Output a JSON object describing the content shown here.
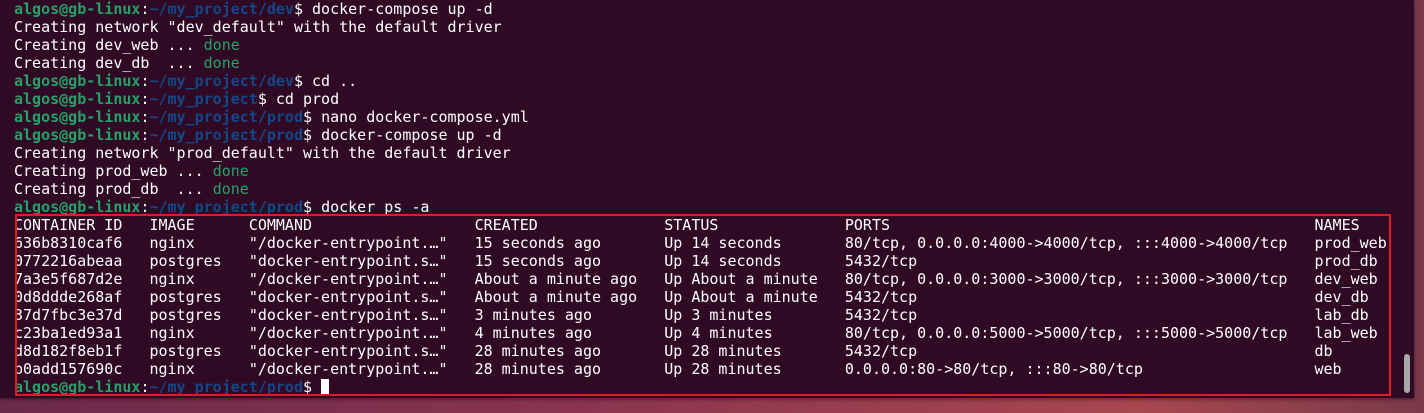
{
  "terminal": {
    "prompt_user": "algos@gb-linux",
    "colors": {
      "user": "#26a269",
      "path": "#12488b",
      "text": "#ffffff",
      "done": "#26a269",
      "background": "#300a24",
      "highlight_box": "#e01b24"
    },
    "history": [
      {
        "type": "prompt",
        "path": "~/my_project/dev",
        "command": "docker-compose up -d"
      },
      {
        "type": "output",
        "text": "Creating network \"dev_default\" with the default driver"
      },
      {
        "type": "status",
        "text": "Creating dev_web ... ",
        "status": "done"
      },
      {
        "type": "status",
        "text": "Creating dev_db  ... ",
        "status": "done"
      },
      {
        "type": "prompt",
        "path": "~/my_project/dev",
        "command": "cd .."
      },
      {
        "type": "prompt",
        "path": "~/my_project",
        "command": "cd prod"
      },
      {
        "type": "prompt",
        "path": "~/my_project/prod",
        "command": "nano docker-compose.yml"
      },
      {
        "type": "prompt",
        "path": "~/my_project/prod",
        "command": "docker-compose up -d"
      },
      {
        "type": "output",
        "text": "Creating network \"prod_default\" with the default driver"
      },
      {
        "type": "status",
        "text": "Creating prod_web ... ",
        "status": "done"
      },
      {
        "type": "status",
        "text": "Creating prod_db  ... ",
        "status": "done"
      },
      {
        "type": "prompt",
        "path": "~/my_project/prod",
        "command": "docker ps -a"
      }
    ],
    "ps_table": {
      "columns": [
        "CONTAINER ID",
        "IMAGE",
        "COMMAND",
        "CREATED",
        "STATUS",
        "PORTS",
        "NAMES"
      ],
      "rows": [
        [
          "636b8310caf6",
          "nginx",
          "\"/docker-entrypoint.…\"",
          "15 seconds ago",
          "Up 14 seconds",
          "80/tcp, 0.0.0.0:4000->4000/tcp, :::4000->4000/tcp",
          "prod_web"
        ],
        [
          "0772216abeaa",
          "postgres",
          "\"docker-entrypoint.s…\"",
          "15 seconds ago",
          "Up 14 seconds",
          "5432/tcp",
          "prod_db"
        ],
        [
          "7a3e5f687d2e",
          "nginx",
          "\"/docker-entrypoint.…\"",
          "About a minute ago",
          "Up About a minute",
          "80/tcp, 0.0.0.0:3000->3000/tcp, :::3000->3000/tcp",
          "dev_web"
        ],
        [
          "0d8ddde268af",
          "postgres",
          "\"docker-entrypoint.s…\"",
          "About a minute ago",
          "Up About a minute",
          "5432/tcp",
          "dev_db"
        ],
        [
          "37d7fbc3e37d",
          "postgres",
          "\"docker-entrypoint.s…\"",
          "3 minutes ago",
          "Up 3 minutes",
          "5432/tcp",
          "lab_db"
        ],
        [
          "c23ba1ed93a1",
          "nginx",
          "\"/docker-entrypoint.…\"",
          "4 minutes ago",
          "Up 4 minutes",
          "80/tcp, 0.0.0.0:5000->5000/tcp, :::5000->5000/tcp",
          "lab_web"
        ],
        [
          "d8d182f8eb1f",
          "postgres",
          "\"docker-entrypoint.s…\"",
          "28 minutes ago",
          "Up 28 minutes",
          "5432/tcp",
          "db"
        ],
        [
          "b0add157690c",
          "nginx",
          "\"/docker-entrypoint.…\"",
          "28 minutes ago",
          "Up 28 minutes",
          "0.0.0.0:80->80/tcp, :::80->80/tcp",
          "web"
        ]
      ]
    },
    "final_prompt": {
      "path": "~/my_project/prod"
    }
  }
}
